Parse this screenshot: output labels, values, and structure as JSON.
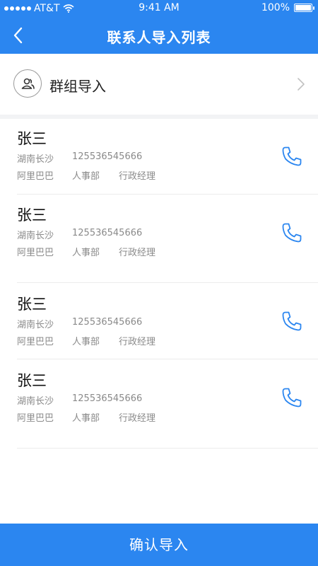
{
  "status": {
    "carrier": "AT&T",
    "time": "9:41 AM",
    "battery": "100%",
    "signal_icon": "signal-dots-icon",
    "wifi_icon": "wifi-icon",
    "battery_icon": "battery-icon"
  },
  "header": {
    "title": "联系人导入列表",
    "back_icon": "chevron-left-icon"
  },
  "group": {
    "label": "群组导入",
    "icon": "group-icon",
    "chevron_icon": "chevron-right-icon"
  },
  "contacts": [
    {
      "name": "张三",
      "location": "湖南长沙",
      "phone": "125536545666",
      "company": "阿里巴巴",
      "department": "人事部",
      "position": "行政经理"
    },
    {
      "name": "张三",
      "location": "湖南长沙",
      "phone": "125536545666",
      "company": "阿里巴巴",
      "department": "人事部",
      "position": "行政经理"
    },
    {
      "name": "张三",
      "location": "湖南长沙",
      "phone": "125536545666",
      "company": "阿里巴巴",
      "department": "人事部",
      "position": "行政经理"
    },
    {
      "name": "张三",
      "location": "湖南长沙",
      "phone": "125536545666",
      "company": "阿里巴巴",
      "department": "人事部",
      "position": "行政经理"
    }
  ],
  "footer": {
    "confirm_label": "确认导入"
  },
  "colors": {
    "primary": "#2b86f0",
    "text_secondary": "#8a8a8a"
  }
}
